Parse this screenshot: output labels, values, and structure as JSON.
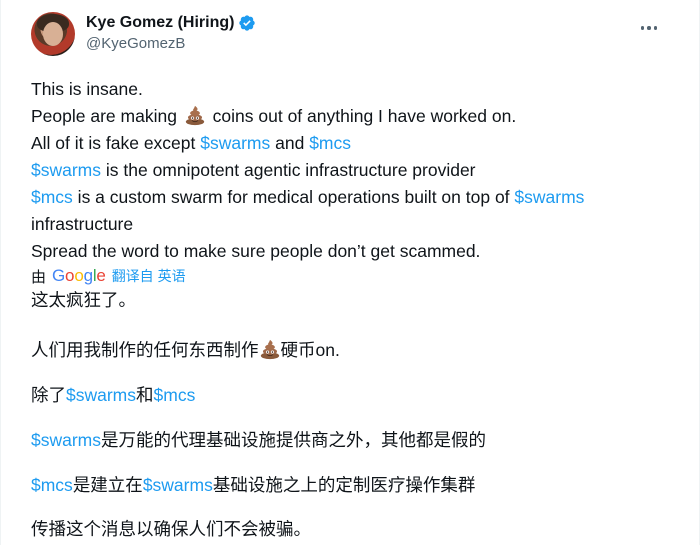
{
  "author": {
    "display_name": "Kye Gomez (Hiring)",
    "handle": "@KyeGomezB",
    "verified": true
  },
  "icons": {
    "more": "more-horizontal-icon",
    "verified": "verified-badge-icon",
    "emoji": "pile-of-poo-emoji"
  },
  "colors": {
    "link": "#1d9bf0",
    "text": "#0f1419",
    "secondary": "#536471",
    "verified": "#1d9bf0"
  },
  "original": {
    "line1": "This is insane.",
    "line2_before": "People are making ",
    "line2_after": " coins out of anything I have worked on.",
    "line3_before": "All of it is fake except ",
    "line3_tag1": "$swarms",
    "line3_mid": " and ",
    "line3_tag2": "$mcs",
    "line4_tag": "$swarms",
    "line4_after": " is the omnipotent agentic infrastructure provider",
    "line5_tag": "$mcs",
    "line5_mid": " is a custom swarm for medical operations built on top of ",
    "line5_tag2": "$swarms",
    "line6": "infrastructure",
    "line7": "Spread the word to make sure people don’t get scammed."
  },
  "translation": {
    "by_label": "由",
    "provider": "Google",
    "link_label": "翻译自 英语",
    "cn1": "这太疯狂了。",
    "cn2_before": "人们用我制作的任何东西制作",
    "cn2_after": "硬币on.",
    "cn3_before": "除了",
    "cn3_tag1": "$swarms",
    "cn3_mid": "和",
    "cn3_tag2": "$mcs",
    "cn4_tag": "$swarms",
    "cn4_after": "是万能的代理基础设施提供商之外，其他都是假的",
    "cn5_tag": "$mcs",
    "cn5_mid": "是建立在",
    "cn5_tag2": "$swarms",
    "cn5_after": "基础设施之上的定制医疗操作集群",
    "cn6": "传播这个消息以确保人们不会被骗。"
  }
}
